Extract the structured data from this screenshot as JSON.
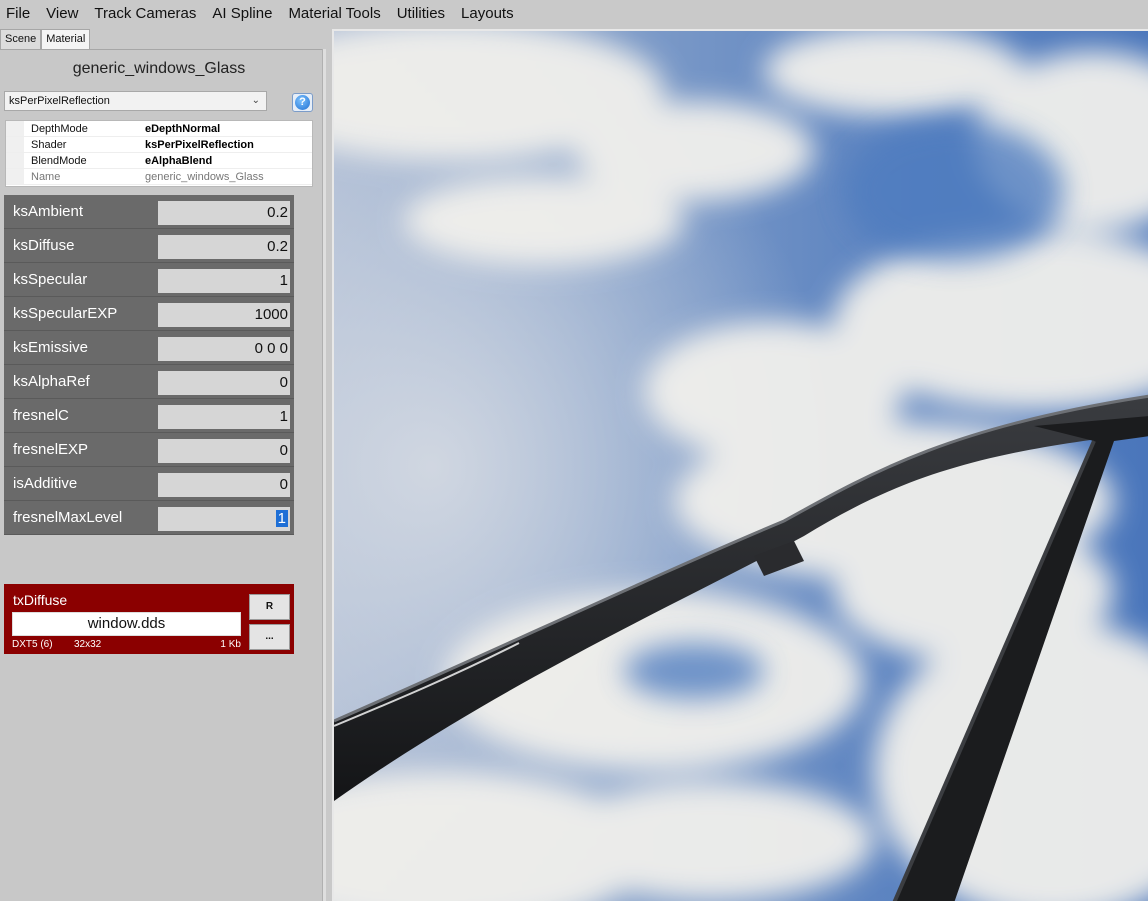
{
  "menu": [
    "File",
    "View",
    "Track Cameras",
    "AI Spline",
    "Material Tools",
    "Utilities",
    "Layouts"
  ],
  "tabs": [
    "Scene",
    "Material"
  ],
  "material": {
    "title": "generic_windows_Glass",
    "shader_select": "ksPerPixelReflection"
  },
  "properties": [
    {
      "key": "DepthMode",
      "value": "eDepthNormal"
    },
    {
      "key": "Shader",
      "value": "ksPerPixelReflection"
    },
    {
      "key": "BlendMode",
      "value": "eAlphaBlend"
    },
    {
      "key": "Name",
      "value": "generic_windows_Glass"
    }
  ],
  "params": [
    {
      "label": "ksAmbient",
      "value": "0.2"
    },
    {
      "label": "ksDiffuse",
      "value": "0.2"
    },
    {
      "label": "ksSpecular",
      "value": "1"
    },
    {
      "label": "ksSpecularEXP",
      "value": "1000"
    },
    {
      "label": "ksEmissive",
      "value": "0 0 0"
    },
    {
      "label": "ksAlphaRef",
      "value": "0"
    },
    {
      "label": "fresnelC",
      "value": "1"
    },
    {
      "label": "fresnelEXP",
      "value": "0"
    },
    {
      "label": "isAdditive",
      "value": "0"
    },
    {
      "label": "fresnelMaxLevel",
      "value": "1"
    }
  ],
  "texture": {
    "label": "txDiffuse",
    "file": "window.dds",
    "format": "DXT5 (6)",
    "size": "32x32",
    "filesize": "1 Kb",
    "btn_r": "R",
    "btn_more": "..."
  },
  "colors": {
    "panel_bg": "#c8c8c8",
    "param_bg": "#6a6a6a",
    "texture_bg": "#8b0000",
    "sky_top": "#3d6fb5",
    "cloud": "#f1f0ec",
    "frame": "#1c1d1f"
  }
}
